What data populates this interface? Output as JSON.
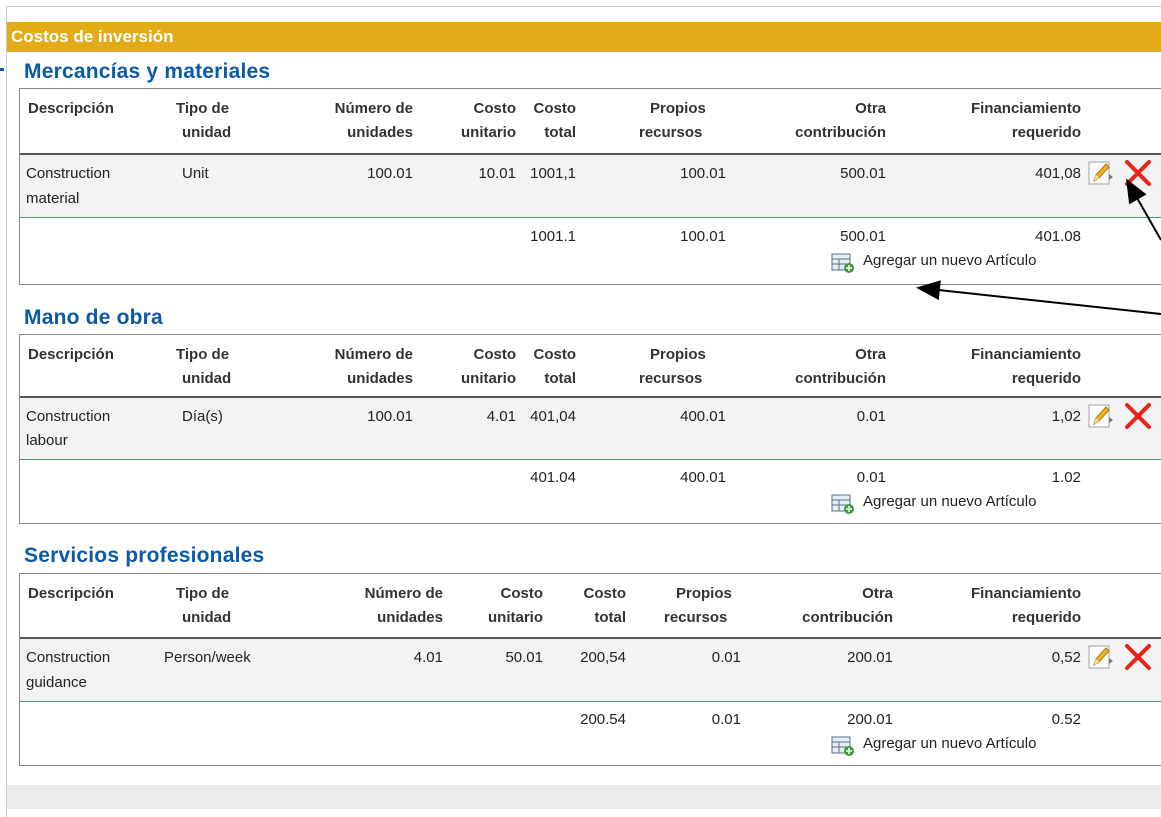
{
  "header": {
    "title": "Costos de inversión"
  },
  "columns": {
    "description": "Descripción",
    "unit_type_1": "Tipo de",
    "unit_type_2": "unidad",
    "num_units_1": "Número de",
    "num_units_2": "unidades",
    "unit_cost_1": "Costo",
    "unit_cost_2": "unitario",
    "total_cost_1": "Costo",
    "total_cost_2": "total",
    "own_resources_1": "Propios",
    "own_resources_2": "recursos",
    "other_contribution_1": "Otra",
    "other_contribution_2": "contribución",
    "financing_1": "Financiamiento",
    "financing_2": "requerido"
  },
  "sections": [
    {
      "title": "Mercancías y materiales",
      "row": {
        "description_1": "Construction",
        "description_2": "material",
        "unit_type": "Unit",
        "num_units": "100.01",
        "unit_cost": "10.01",
        "total_cost": "1001,1",
        "own_resources": "100.01",
        "other_contribution": "500.01",
        "financing": "401,08"
      },
      "totals": {
        "total_cost": "1001.1",
        "own_resources": "100.01",
        "other_contribution": "500.01",
        "financing": "401.08"
      },
      "add_label": "Agregar un nuevo Artículo"
    },
    {
      "title": "Mano de obra",
      "row": {
        "description_1": "Construction",
        "description_2": "labour",
        "unit_type": "Día(s)",
        "num_units": "100.01",
        "unit_cost": "4.01",
        "total_cost": "401,04",
        "own_resources": "400.01",
        "other_contribution": "0.01",
        "financing": "1,02"
      },
      "totals": {
        "total_cost": "401.04",
        "own_resources": "400.01",
        "other_contribution": "0.01",
        "financing": "1.02"
      },
      "add_label": "Agregar un nuevo Artículo"
    },
    {
      "title": "Servicios profesionales",
      "row": {
        "description_1": "Construction",
        "description_2": "guidance",
        "unit_type": "Person/week",
        "num_units": "4.01",
        "unit_cost": "50.01",
        "total_cost": "200,54",
        "own_resources": "0.01",
        "other_contribution": "200.01",
        "financing": "0,52"
      },
      "totals": {
        "total_cost": "200.54",
        "own_resources": "0.01",
        "other_contribution": "200.01",
        "financing": "0.52"
      },
      "add_label": "Agregar un nuevo Artículo"
    }
  ],
  "icons": {
    "edit": "pencil-edit-icon",
    "delete": "red-x-delete-icon",
    "add": "add-row-table-icon"
  },
  "colors": {
    "header_bar": "#e3ac16",
    "section_title": "#0a5aa8",
    "delete": "#e8231a",
    "row_separator": "#4a9a6a"
  }
}
